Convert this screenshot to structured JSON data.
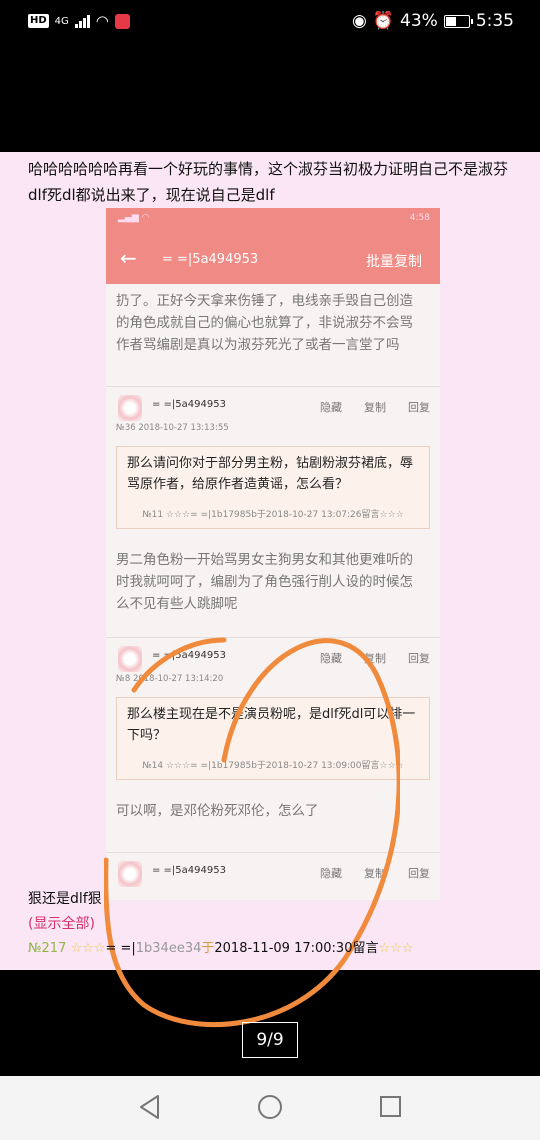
{
  "status_bar": {
    "hd": "HD",
    "network": "4G",
    "battery_percent": "43%",
    "time": "5:35",
    "icons": [
      "signal-icon",
      "wifi-icon",
      "app-notification-icon",
      "eye-icon",
      "alarm-icon",
      "battery-icon"
    ]
  },
  "post": {
    "text": "哈哈哈哈哈哈再看一个好玩的事情，这个淑芬当初极力证明自己不是淑芬dlf死dl都说出来了，现在说自己是dlf"
  },
  "screenshot": {
    "status_time": "4:58",
    "title": "= =|5a494953",
    "action": "批量复制",
    "top_text": "扔了。正好今天拿来伤锤了，电线亲手毁自己创造的角色成就自己的偏心也就算了，非说淑芬不会骂作者骂编剧是真以为淑芬死光了或者一言堂了吗",
    "comments": [
      {
        "name": "= =|5a494953",
        "meta": "№36  2018-10-27 13:13:55",
        "actions": [
          "隐藏",
          "复制",
          "回复"
        ],
        "quote": "那么请问你对于部分男主粉，钻剧粉淑芬裙底，辱骂原作者，给原作者造黄谣，怎么看？",
        "quote_foot": "№11 ☆☆☆= =|1b17985b于2018-10-27 13:07:26留言☆☆☆",
        "reply": "男二角色粉一开始骂男女主狗男女和其他更难听的时我就呵呵了，编剧为了角色强行削人设的时候怎么不见有些人跳脚呢"
      },
      {
        "name": "= =|5a494953",
        "meta": "№8  2018-10-27 13:14:20",
        "actions": [
          "隐藏",
          "复制",
          "回复"
        ],
        "quote": "那么楼主现在是不是演员粉呢，是dlf死dl可以排一下吗？",
        "quote_foot": "№14 ☆☆☆= =|1b17985b于2018-10-27 13:09:00留言☆☆☆",
        "reply": "可以啊，是邓伦粉死邓伦，怎么了"
      }
    ],
    "partial_name": "= =|5a494953"
  },
  "footer": {
    "line1": "狠还是dlf狠",
    "show_all": "(显示全部)",
    "num": "№217",
    "stars": "☆☆☆",
    "prefix": "= =|",
    "uid": "1b34ee34",
    "yu": "于",
    "datetime": "2018-11-09 17:00:30留言",
    "stars_end": "☆☆☆"
  },
  "pager": "9/9",
  "colors": {
    "page_bg": "#fbe6f5",
    "header_bg": "#f08a84",
    "annotation_circle": "#f08a3c"
  }
}
